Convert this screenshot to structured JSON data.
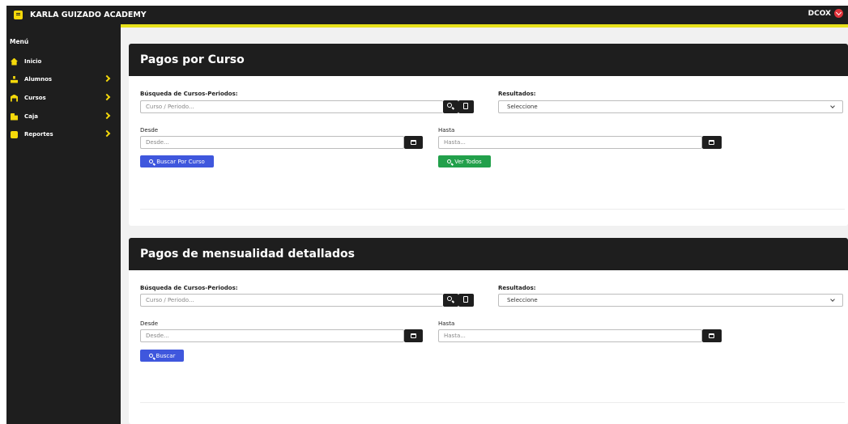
{
  "header": {
    "brand": "KARLA GUIZADO ACADEMY",
    "user": "DCOX"
  },
  "sidebar": {
    "title": "Menú",
    "items": [
      {
        "label": "Inicio",
        "icon": "home-icon"
      },
      {
        "label": "Alumnos",
        "icon": "user-icon"
      },
      {
        "label": "Cursos",
        "icon": "graduation-icon"
      },
      {
        "label": "Caja",
        "icon": "cash-box-icon"
      },
      {
        "label": "Reportes",
        "icon": "report-icon"
      }
    ]
  },
  "cards": [
    {
      "title": "Pagos por Curso",
      "search_label": "Búsqueda de Cursos-Periodos:",
      "search_placeholder": "Curso / Periodo...",
      "results_label": "Resultados:",
      "results_value": "Seleccione",
      "from_label": "Desde",
      "from_placeholder": "Desde...",
      "to_label": "Hasta",
      "to_placeholder": "Hasta...",
      "primary_button": "Buscar Por Curso",
      "secondary_button": "Ver Todos"
    },
    {
      "title": "Pagos de mensualidad detallados",
      "search_label": "Búsqueda de Cursos-Periodos:",
      "search_placeholder": "Curso / Periodo...",
      "results_label": "Resultados:",
      "results_value": "Seleccione",
      "from_label": "Desde",
      "from_placeholder": "Desde...",
      "to_label": "Hasta",
      "to_placeholder": "Hasta...",
      "primary_button": "Buscar"
    }
  ],
  "colors": {
    "dark": "#1e1e1e",
    "accent_yellow": "#f5d90a",
    "accent_bar": "#e8e21b",
    "primary_blue": "#3f57dd",
    "success_green": "#22a04b",
    "user_red": "#e2333b"
  }
}
